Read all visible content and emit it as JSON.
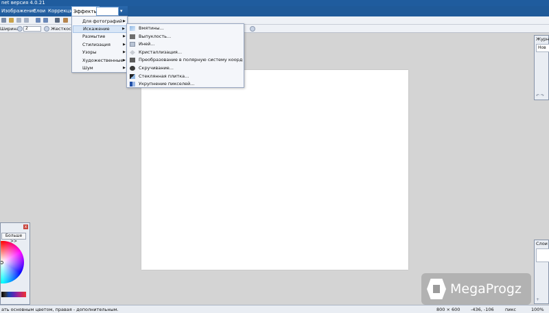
{
  "titlebar": {
    "title": "net версия 4.0.21"
  },
  "menubar": {
    "items": [
      {
        "label": "Изображение"
      },
      {
        "label": "Слои"
      },
      {
        "label": "Коррекция"
      },
      {
        "label": "Эффекты"
      }
    ],
    "active": "Эффекты"
  },
  "toolbar": {
    "width_label": "Ширина:",
    "width_value": "2",
    "hardness_label": "Жесткость"
  },
  "effects_menu": {
    "items": [
      {
        "label": "Для фотографий",
        "has_submenu": true
      },
      {
        "label": "Искажение",
        "has_submenu": true,
        "highlighted": true
      },
      {
        "label": "Размытие",
        "has_submenu": true
      },
      {
        "label": "Стилизация",
        "has_submenu": true
      },
      {
        "label": "Узоры",
        "has_submenu": true
      },
      {
        "label": "Художественные",
        "has_submenu": true
      },
      {
        "label": "Шум",
        "has_submenu": true
      }
    ],
    "arrow_glyph": "▶"
  },
  "distort_submenu": {
    "items": [
      {
        "label": "Вмятины...",
        "icon": "dents-icon"
      },
      {
        "label": "Выпуклость...",
        "icon": "bulge-icon"
      },
      {
        "label": "Иней...",
        "icon": "frost-icon"
      },
      {
        "label": "Кристаллизация...",
        "icon": "crystallize-icon"
      },
      {
        "label": "Преобразование в полярную систему координат...",
        "icon": "polar-icon"
      },
      {
        "label": "Скручивание...",
        "icon": "twist-icon"
      },
      {
        "label": "Стеклянная плитка...",
        "icon": "tile-icon"
      },
      {
        "label": "Укрупнение пикселей...",
        "icon": "pixelate-icon"
      }
    ]
  },
  "history_panel": {
    "title": "Журна...",
    "item": "Нов"
  },
  "layers_panel": {
    "title": "Слои"
  },
  "colors_panel": {
    "more_label": "Больше >>",
    "close_glyph": "x"
  },
  "statusbar": {
    "hint": "ать основным цветом, правая - дополнительным.",
    "size": "800 × 600",
    "coords": "-436, -106",
    "units": "пикс",
    "zoom": "100%"
  },
  "watermark": {
    "text": "MegaProgz"
  },
  "colors": {
    "menubar": "#1f5a99",
    "titlebar": "#1f5c9e",
    "workspace": "#d4d4d4",
    "highlight": "#d8e6f7"
  }
}
